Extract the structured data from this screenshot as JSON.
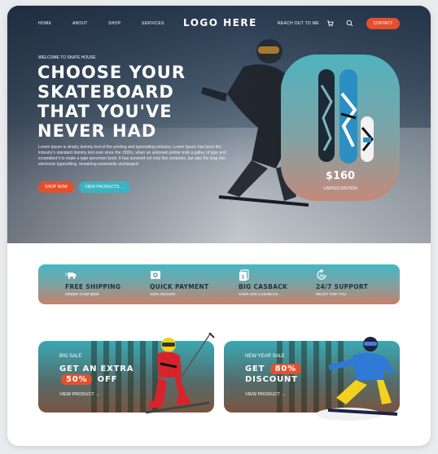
{
  "nav": {
    "home": "HOME",
    "about": "ABOUT",
    "shop": "SHOP",
    "services": "SERVICES",
    "logo": "LOGO HERE",
    "reach": "REACH OUT TO ME",
    "contact": "CONTACT"
  },
  "hero": {
    "welcome": "WELCOME TO SKATE HOUSE",
    "headline": [
      "CHOOSE YOUR",
      "SKATEBOARD",
      "THAT YOU'VE",
      "NEVER HAD"
    ],
    "body": "Lorem Ipsum is simply dummy text of the printing and typesetting industry. Lorem Ipsum has been the industry's standard dummy text ever since the 1500s, when an unknown printer took a galley of type and scrambled it to make a type specimen book. It has survived not only five centuries, but also the leap into electronic typesetting, remaining essentially unchanged.",
    "shop_now": "SHOP NOW",
    "view_products": "VIEW PRODUCTS →"
  },
  "product_card": {
    "price": "$160",
    "edition": "LIMITED EDITION"
  },
  "features": [
    {
      "icon": "truck-icon",
      "title": "FREE SHIPPING",
      "sub": "ORDER OVER $500"
    },
    {
      "icon": "wallet-icon",
      "title": "QUICK PAYMENT",
      "sub": "100% SECURE"
    },
    {
      "icon": "cashback-icon",
      "title": "BIG CASBACK",
      "sub": "OVER 40% CASHBACK"
    },
    {
      "icon": "support-24-icon",
      "title": "24/7 SUPPORT",
      "sub": "READY FOR YOU"
    }
  ],
  "promos": [
    {
      "tag": "BIG SALE",
      "line1_pre": "GET AN EXTRA",
      "pill": "50%",
      "line2": "OFF",
      "cta": "VIEW PRODUCT →"
    },
    {
      "tag": "NEW YEAR SALE",
      "line1_pre": "GET",
      "pill": "80%",
      "line2": "DISCOUNT",
      "cta": "VIEW PRODUCT →"
    }
  ],
  "colors": {
    "accent": "#e4502e",
    "teal": "#3bb3c0",
    "dark": "#1e3342"
  }
}
